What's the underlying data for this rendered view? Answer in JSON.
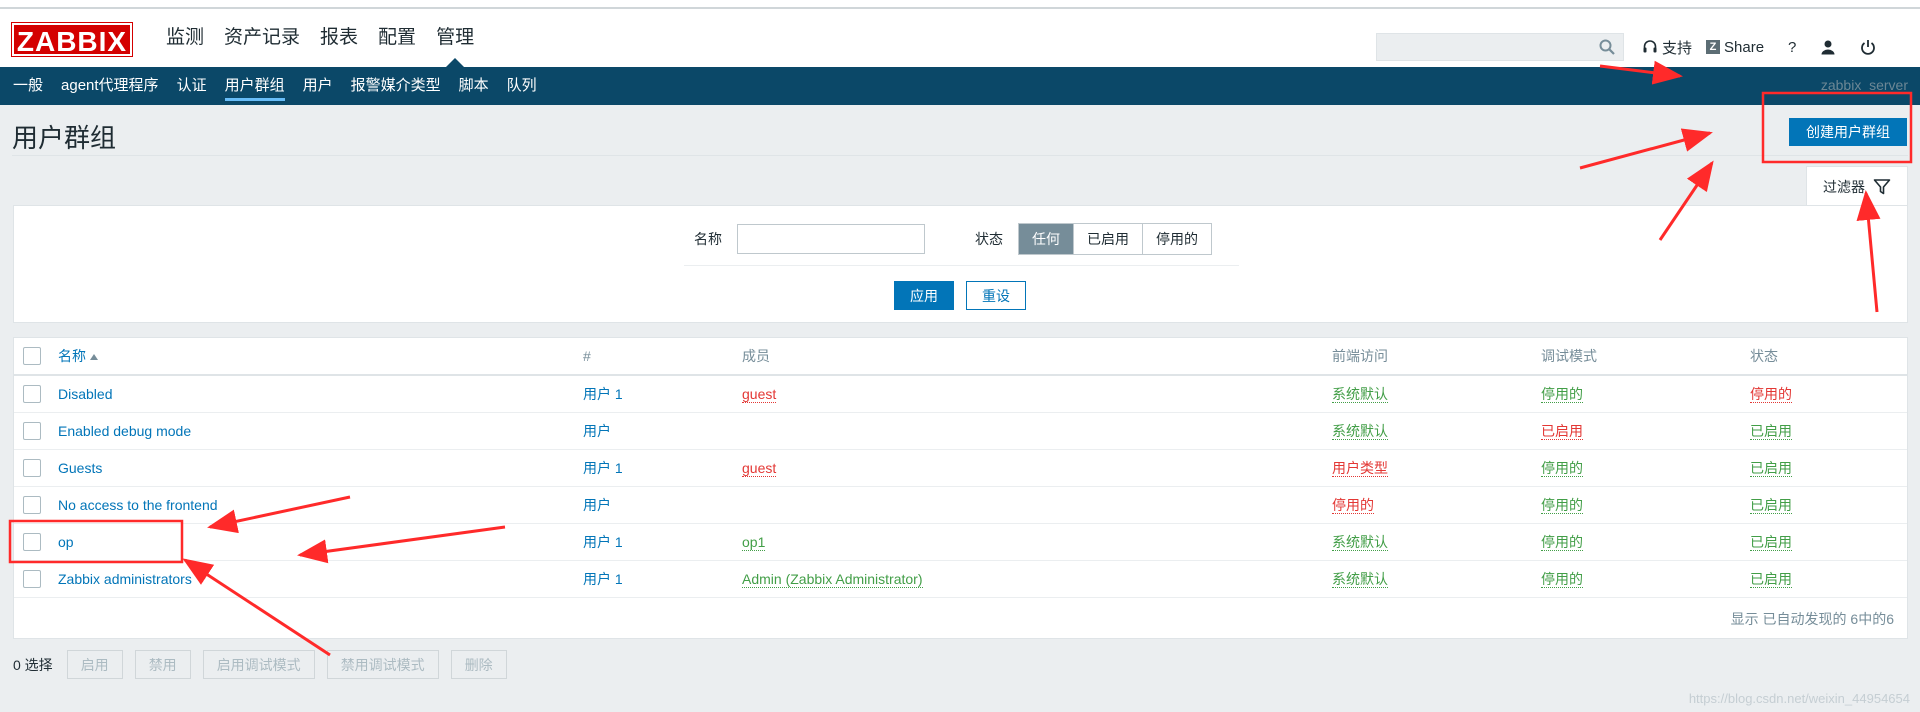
{
  "header": {
    "logo": "ZABBIX",
    "nav": [
      "监测",
      "资产记录",
      "报表",
      "配置",
      "管理"
    ],
    "active_nav": 4,
    "support": "支持",
    "share": "Share",
    "help": "?"
  },
  "subnav": {
    "items": [
      "一般",
      "agent代理程序",
      "认证",
      "用户群组",
      "用户",
      "报警媒介类型",
      "脚本",
      "队列"
    ],
    "active": 3,
    "server": "zabbix_server"
  },
  "page": {
    "title": "用户群组",
    "create_button": "创建用户群组",
    "filter_tab": "过滤器"
  },
  "filter": {
    "name_label": "名称",
    "name_value": "",
    "status_label": "状态",
    "status_options": [
      "任何",
      "已启用",
      "停用的"
    ],
    "status_selected": 0,
    "apply": "应用",
    "reset": "重设"
  },
  "table": {
    "headers": [
      "名称",
      "#",
      "成员",
      "前端访问",
      "调试模式",
      "状态"
    ],
    "rows": [
      {
        "name": "Disabled",
        "users": "用户",
        "count": "1",
        "members": "guest",
        "frontend": "系统默认",
        "debug": "停用的",
        "status": "停用的"
      },
      {
        "name": "Enabled debug mode",
        "users": "用户",
        "count": "",
        "members": "",
        "frontend": "系统默认",
        "debug": "已启用",
        "status": "已启用"
      },
      {
        "name": "Guests",
        "users": "用户",
        "count": "1",
        "members": "guest",
        "frontend": "用户类型",
        "debug": "停用的",
        "status": "已启用"
      },
      {
        "name": "No access to the frontend",
        "users": "用户",
        "count": "",
        "members": "",
        "frontend": "停用的",
        "debug": "停用的",
        "status": "已启用"
      },
      {
        "name": "op",
        "users": "用户",
        "count": "1",
        "members": "op1",
        "frontend": "系统默认",
        "debug": "停用的",
        "status": "已启用"
      },
      {
        "name": "Zabbix administrators",
        "users": "用户",
        "count": "1",
        "members": "Admin (Zabbix Administrator)",
        "frontend": "系统默认",
        "debug": "停用的",
        "status": "已启用"
      }
    ],
    "footer": "显示 已自动发现的 6中的6"
  },
  "actions": {
    "selected": "0 选择",
    "buttons": [
      "启用",
      "禁用",
      "启用调试模式",
      "禁用调试模式",
      "删除"
    ]
  },
  "watermark": "https://blog.csdn.net/weixin_44954654",
  "colors": {
    "brand": "#d40000",
    "subnav": "#0b4868",
    "primary": "#0275b8",
    "enabled": "#429e47",
    "disabled": "#e33734",
    "annotation": "#ff2a2a"
  }
}
